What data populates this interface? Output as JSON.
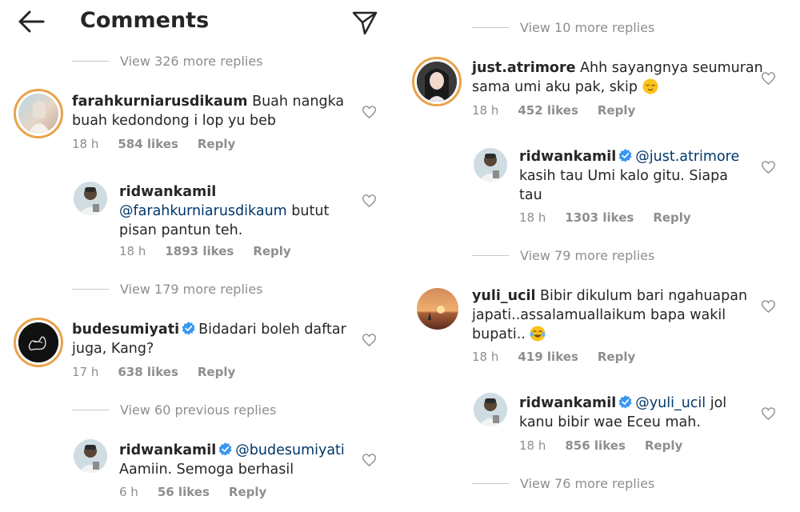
{
  "header": {
    "title": "Comments"
  },
  "left": {
    "view_more_top": "View 326 more replies",
    "c1": {
      "user": "farahkurniarusdikaum",
      "line1": "Buah nangka",
      "line2": "buah kedondong i lop yu beb",
      "time": "18 h",
      "likes": "584 likes",
      "reply": "Reply"
    },
    "r1": {
      "user": "ridwankamil",
      "mention": "@farahkurniarusdikaum",
      "line1_rest": "butut",
      "line2": "pisan pantun teh.",
      "time": "18 h",
      "likes": "1893 likes",
      "reply": "Reply"
    },
    "view_more_2": "View 179 more replies",
    "c2": {
      "user": "budesumiyati",
      "line1": "Bidadari boleh daftar",
      "line2": "juga, Kang?",
      "time": "17 h",
      "likes": "638 likes",
      "reply": "Reply"
    },
    "view_prev": "View 60 previous replies",
    "r2": {
      "user": "ridwankamil",
      "mention": "@budesumiyati",
      "line2": "Aamiin. Semoga berhasil",
      "time": "6 h",
      "likes": "56 likes",
      "reply": "Reply"
    }
  },
  "right": {
    "view_more_top": "View 10 more replies",
    "c3": {
      "user": "just.atrimore",
      "line1": "Ahh sayangnya seumuran",
      "line2": "sama umi aku pak, skip",
      "time": "18 h",
      "likes": "452 likes",
      "reply": "Reply"
    },
    "r3": {
      "user": "ridwankamil",
      "mention": "@just.atrimore",
      "line2": "kasih tau Umi kalo gitu. Siapa",
      "line3": "tau",
      "time": "18 h",
      "likes": "1303 likes",
      "reply": "Reply"
    },
    "view_more_2": "View 79 more replies",
    "c4": {
      "user": "yuli_ucil",
      "line1": "Bibir dikulum bari ngahuapan",
      "line2": "japati..assalamuallaikum bapa wakil",
      "line3": "bupati..",
      "time": "18 h",
      "likes": "419 likes",
      "reply": "Reply"
    },
    "r4": {
      "user": "ridwankamil",
      "mention": "@yuli_ucil",
      "line1_rest": "jol",
      "line2": "kanu bibir wae Eceu mah.",
      "time": "18 h",
      "likes": "856 likes",
      "reply": "Reply"
    },
    "view_more_3": "View 76 more replies"
  },
  "colors": {
    "verified": "#3897f0",
    "mention": "#00376b",
    "muted": "#8e8e8e",
    "ring": "#e9a24a"
  }
}
